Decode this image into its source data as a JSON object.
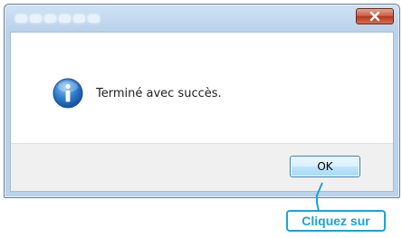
{
  "dialog": {
    "title": "",
    "message": "Terminé avec succès.",
    "ok_label": "OK",
    "close_glyph": "×",
    "icon": "info-icon"
  },
  "annotation": {
    "callout_text": "Cliquez sur",
    "accent_color": "#1aa3d9"
  },
  "colors": {
    "close_button": "#c95a3f",
    "ok_button_border": "#3c7fb1",
    "footer_bg": "#f0f0f0"
  }
}
